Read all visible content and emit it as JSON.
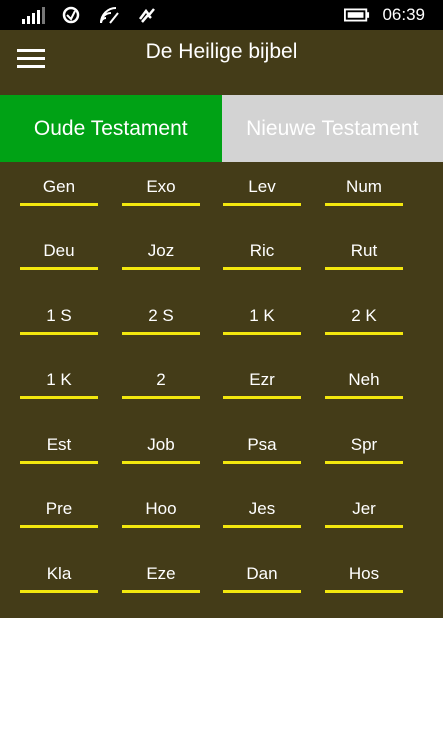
{
  "status_bar": {
    "time": "06:39",
    "icons": [
      "signal-icon",
      "sync-icon",
      "wifi-icon",
      "nfc-icon",
      "battery-icon"
    ]
  },
  "header": {
    "title": "De Heilige bijbel",
    "menu_icon": "hamburger-menu-icon"
  },
  "tabs": {
    "old_testament": "Oude Testament",
    "new_testament": "Nieuwe Testament",
    "active": "old_testament"
  },
  "books": [
    "Gen",
    "Exo",
    "Lev",
    "Num",
    "Deu",
    "Joz",
    "Ric",
    "Rut",
    "1 S",
    "2 S",
    "1 K",
    "2 K",
    "1 K",
    "2",
    "Ezr",
    "Neh",
    "Est",
    "Job",
    "Psa",
    "Spr",
    "Pre",
    "Hoo",
    "Jes",
    "Jer",
    "Kla",
    "Eze",
    "Dan",
    "Hos"
  ],
  "colors": {
    "background": "#443c18",
    "active_tab": "#00a215",
    "inactive_tab": "#d3d3d3",
    "underline": "#f3e70e"
  }
}
